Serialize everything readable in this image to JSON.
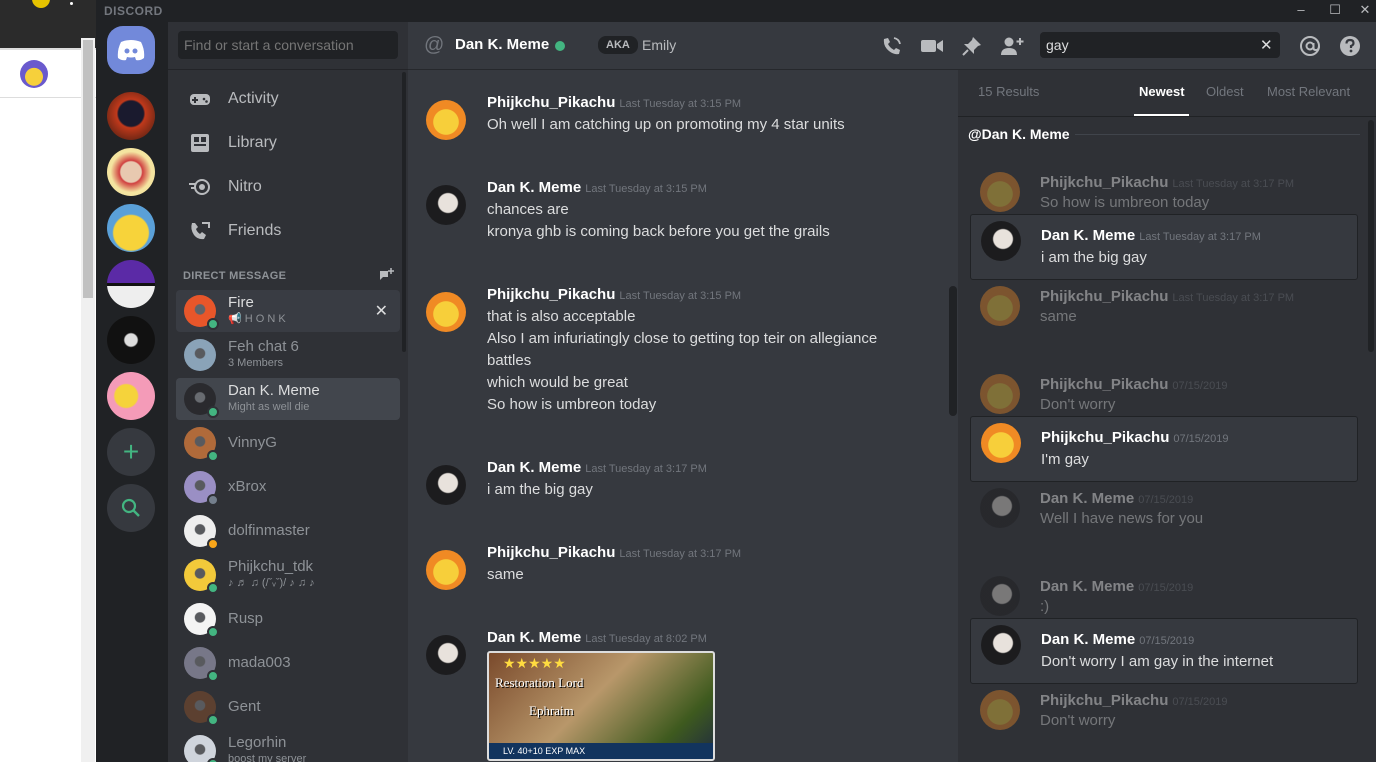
{
  "window": {
    "brand": "DISCORD",
    "controls": [
      "–",
      "☐",
      "✕"
    ]
  },
  "dm_sidebar": {
    "search_placeholder": "Find or start a conversation",
    "nav": [
      {
        "label": "Activity",
        "icon": "gamepad-icon"
      },
      {
        "label": "Library",
        "icon": "library-icon"
      },
      {
        "label": "Nitro",
        "icon": "nitro-icon"
      },
      {
        "label": "Friends",
        "icon": "friends-icon"
      }
    ],
    "header": "DIRECT MESSAGE",
    "dms": [
      {
        "name": "Fire",
        "sub": "📢 H O N K",
        "status": "online",
        "color": "#e8562a"
      },
      {
        "name": "Feh chat 6",
        "sub": "3 Members",
        "status": "none",
        "color": "#8aa3b8"
      },
      {
        "name": "Dan K. Meme",
        "sub": "Might as well die",
        "status": "online",
        "color": "#2a2a2e"
      },
      {
        "name": "VinnyG",
        "sub": "",
        "status": "online",
        "color": "#b06a3a"
      },
      {
        "name": "xBrox",
        "sub": "",
        "status": "idle",
        "color": "#9a8fc4"
      },
      {
        "name": "dolfinmaster",
        "sub": "",
        "status": "dnd",
        "color": "#eeeeee"
      },
      {
        "name": "Phijkchu_tdk",
        "sub": "♪ ♬ ♫ (/ˇᵥˇ)/ ♪ ♫ ♪",
        "status": "online",
        "color": "#f2c93a"
      },
      {
        "name": "Rusp",
        "sub": "",
        "status": "online",
        "color": "#f4f4f4"
      },
      {
        "name": "mada003",
        "sub": "",
        "status": "online",
        "color": "#777788"
      },
      {
        "name": "Gent",
        "sub": "",
        "status": "online",
        "color": "#5c4030"
      },
      {
        "name": "Legorhin",
        "sub": "boost my server",
        "status": "online",
        "color": "#cfd4dc"
      }
    ]
  },
  "chat": {
    "title": "Dan K. Meme",
    "aka": "AKA",
    "aka_name": "Emily",
    "search_value": "gay",
    "messages": [
      {
        "user": "Phijkchu_Pikachu",
        "avatar": "pika",
        "time": "Last Tuesday at 3:15 PM",
        "lines": [
          "Oh well I am catching up on promoting my 4 star units"
        ]
      },
      {
        "user": "Dan K. Meme",
        "avatar": "dan",
        "time": "Last Tuesday at 3:15 PM",
        "lines": [
          "chances are",
          "kronya ghb is coming back before you get the grails"
        ]
      },
      {
        "user": "Phijkchu_Pikachu",
        "avatar": "pika",
        "time": "Last Tuesday at 3:15 PM",
        "lines": [
          "that is also acceptable",
          "Also I am infuriatingly close to getting top teir on allegiance",
          "battles",
          "which would be great",
          "So how is umbreon today"
        ]
      },
      {
        "user": "Dan K. Meme",
        "avatar": "dan",
        "time": "Last Tuesday at 3:17 PM",
        "lines": [
          "i am the big gay"
        ]
      },
      {
        "user": "Phijkchu_Pikachu",
        "avatar": "pika",
        "time": "Last Tuesday at 3:17 PM",
        "lines": [
          "same"
        ]
      },
      {
        "user": "Dan K. Meme",
        "avatar": "dan",
        "time": "Last Tuesday at 8:02 PM",
        "lines": []
      }
    ],
    "embed": {
      "stars": "★★★★★",
      "line1": "Restoration Lord",
      "line2": "Ephraim",
      "bar": "LV. 40+10   EXP   MAX"
    }
  },
  "search_results": {
    "count": "15 Results",
    "tabs": [
      "Newest",
      "Oldest",
      "Most Relevant"
    ],
    "channel": "@Dan K. Meme",
    "items": [
      {
        "user": "Phijkchu_Pikachu",
        "avatar": "pika",
        "time": "Last Tuesday at 3:17 PM",
        "text": "So how is umbreon today",
        "kind": "ctx"
      },
      {
        "user": "Dan K. Meme",
        "avatar": "dan",
        "time": "Last Tuesday at 3:17 PM",
        "text": "i am the big gay",
        "kind": "hit"
      },
      {
        "user": "Phijkchu_Pikachu",
        "avatar": "pika",
        "time": "Last Tuesday at 3:17 PM",
        "text": "same",
        "kind": "ctx"
      },
      {
        "user": "Phijkchu_Pikachu",
        "avatar": "pika",
        "time": "07/15/2019",
        "text": "Don't worry",
        "kind": "ctx"
      },
      {
        "user": "Phijkchu_Pikachu",
        "avatar": "pika",
        "time": "07/15/2019",
        "text": "I'm gay",
        "kind": "hit"
      },
      {
        "user": "Dan K. Meme",
        "avatar": "dan",
        "time": "07/15/2019",
        "text": "Well I have news for you",
        "kind": "ctx"
      },
      {
        "user": "Dan K. Meme",
        "avatar": "dan",
        "time": "07/15/2019",
        "text": ":)",
        "kind": "ctx"
      },
      {
        "user": "Dan K. Meme",
        "avatar": "dan",
        "time": "07/15/2019",
        "text": "Don't worry I am gay in the internet",
        "kind": "hit"
      },
      {
        "user": "Phijkchu_Pikachu",
        "avatar": "pika",
        "time": "07/15/2019",
        "text": "Don't worry",
        "kind": "ctx"
      }
    ]
  },
  "colors": {
    "accent": "#7289da",
    "online": "#43b581",
    "idle": "#747f8d",
    "dnd": "#faa61a"
  }
}
